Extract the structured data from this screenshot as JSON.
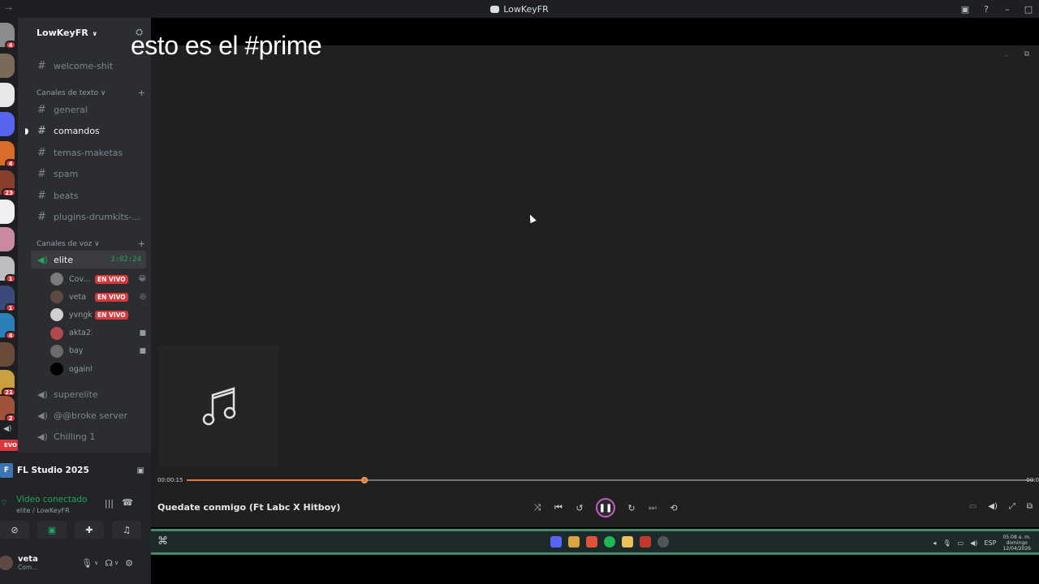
{
  "window": {
    "title": "LowKeyFR"
  },
  "server": {
    "name": "LowKeyFR",
    "pinned_channel": "welcome-shit",
    "text_category": "Canales de texto",
    "text_channels": [
      "general",
      "comandos",
      "temas-maketas",
      "spam",
      "beats",
      "plugins-drumkits-..."
    ],
    "voice_category": "Canales de voz",
    "active_voice": {
      "name": "elite",
      "timer": "3:02:24"
    },
    "voice_users": [
      {
        "name": "Cov...",
        "live": "EN VIVO",
        "end_icon": "😀",
        "avatar": "#7a7a7a"
      },
      {
        "name": "veta",
        "live": "EN VIVO",
        "end_icon": "◎",
        "avatar": "#5d4a42"
      },
      {
        "name": "yvngke...",
        "live": "EN VIVO",
        "end_icon": "",
        "avatar": "#cfcfcf"
      },
      {
        "name": "akta222",
        "live": "",
        "end_icon": "■",
        "avatar": "#b5484f"
      },
      {
        "name": "bay",
        "live": "",
        "end_icon": "■",
        "avatar": "#6b6b6b"
      },
      {
        "name": "ogaint",
        "live": "",
        "end_icon": "",
        "avatar": "#000000"
      }
    ],
    "other_voice": [
      "superelite",
      "@@broke server",
      "Chilling 1"
    ]
  },
  "rail": {
    "badges": [
      "4",
      "4",
      "23",
      "1",
      "1",
      "4",
      "21",
      "2"
    ],
    "live_pill": "EVO"
  },
  "activity": {
    "app_name": "FL Studio 2025"
  },
  "voice_status": {
    "title": "Video conectado",
    "subtitle": "elite / LowKeyFR"
  },
  "me": {
    "name": "veta",
    "status": "Com..."
  },
  "stream": {
    "caption": "esto es el #prime"
  },
  "player": {
    "current_time": "00:00:15",
    "end_time": "00:0",
    "progress": 0.21,
    "song_title": "Quedate conmigo (Ft Labc X Hitboy)"
  },
  "taskbar": {
    "lang": "ESP",
    "clock_time": "05:08 a. m.",
    "clock_day": "domingo",
    "clock_date": "12/04/2026"
  },
  "colors": {
    "accent": "#e87a3a",
    "discord_green": "#23a55a",
    "live_red": "#da373c"
  }
}
